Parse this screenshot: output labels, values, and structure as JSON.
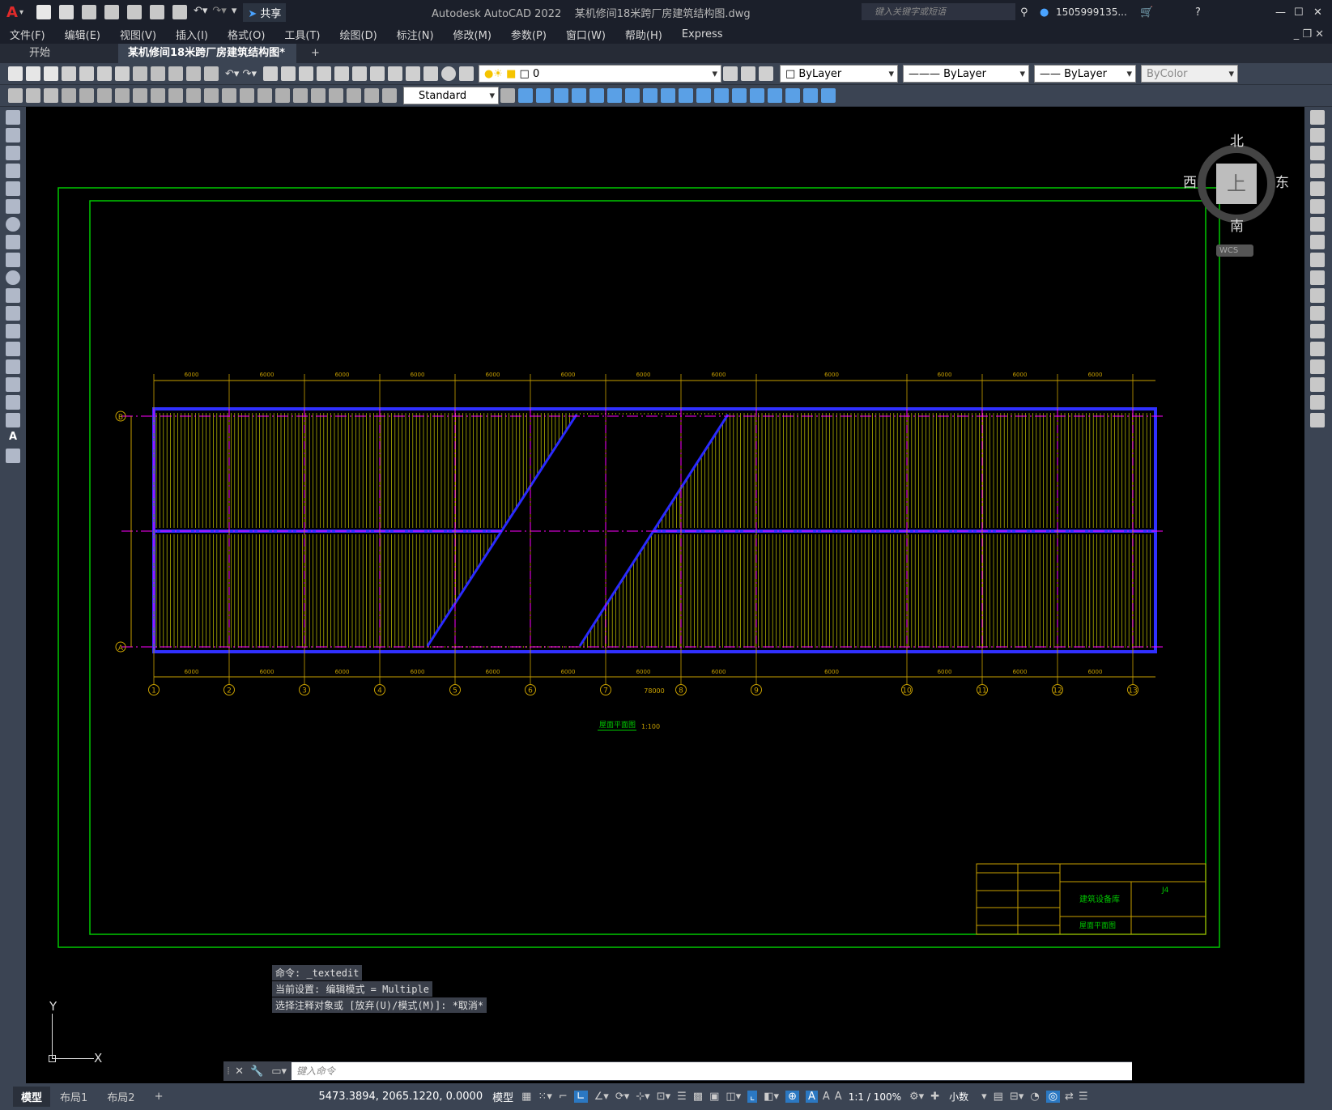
{
  "app": {
    "title": "Autodesk AutoCAD 2022",
    "file": "某机修间18米跨厂房建筑结构图.dwg",
    "share": "共享",
    "search_placeholder": "键入关键字或短语",
    "user": "1505999135..."
  },
  "menu": [
    "文件(F)",
    "编辑(E)",
    "视图(V)",
    "插入(I)",
    "格式(O)",
    "工具(T)",
    "绘图(D)",
    "标注(N)",
    "修改(M)",
    "参数(P)",
    "窗口(W)",
    "帮助(H)",
    "Express"
  ],
  "tabs": {
    "start": "开始",
    "active": "某机修间18米跨厂房建筑结构图*",
    "add": "+"
  },
  "props": {
    "layer": "0",
    "color": "ByLayer",
    "linetype": "ByLayer",
    "lineweight": "ByLayer",
    "plotstyle": "ByColor",
    "textstyle": "Standard"
  },
  "viewcube": {
    "n": "北",
    "s": "南",
    "e": "东",
    "w": "西",
    "top": "上",
    "wcs": "WCS"
  },
  "ucs": {
    "x": "X",
    "y": "Y"
  },
  "drawing": {
    "title": "屋面平面图",
    "scale": "1:100",
    "total_dim": "78000",
    "axes": [
      "1",
      "2",
      "3",
      "4",
      "5",
      "6",
      "7",
      "8",
      "9",
      "10",
      "11",
      "12",
      "13"
    ],
    "rows": [
      "B",
      "A"
    ],
    "span_dims": [
      "6000",
      "6000",
      "6000",
      "6000",
      "6000",
      "6000",
      "6000",
      "6000",
      "6000",
      "6000",
      "6000",
      "6000"
    ],
    "titleblock": {
      "company": "建筑设备库",
      "sheet": "屋面平面图",
      "drawing_no": "J4"
    }
  },
  "command": {
    "line1": "命令: _textedit",
    "line2": "当前设置: 编辑模式 = Multiple",
    "line3": "选择注释对象或 [放弃(U)/模式(M)]: *取消*",
    "placeholder": "键入命令"
  },
  "layout_tabs": [
    "模型",
    "布局1",
    "布局2",
    "+"
  ],
  "status": {
    "coords": "5473.3894, 2065.1220, 0.0000",
    "model": "模型",
    "scale": "1:1 / 100%",
    "units": "小数"
  }
}
